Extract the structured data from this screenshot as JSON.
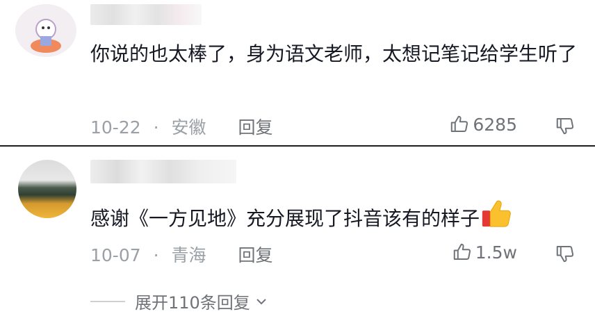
{
  "comments": [
    {
      "text": "你说的也太棒了，身为语文老师，太想记笔记给学生听了",
      "date": "10-22",
      "location": "安徽",
      "reply_label": "回复",
      "likes": "6285"
    },
    {
      "text": "感谢《一方见地》充分展现了抖音该有的样子",
      "date": "10-07",
      "location": "青海",
      "reply_label": "回复",
      "likes": "1.5w"
    }
  ],
  "separator": "·",
  "expand_label": "展开110条回复",
  "icons": {
    "like": "thumbs-up-outline-icon",
    "dislike": "thumbs-down-outline-icon",
    "expand": "chevron-down-icon",
    "emoji": "thumbs-up-emoji"
  },
  "colors": {
    "text": "#161823",
    "meta": "#9aa0a6",
    "action": "#6f7378"
  }
}
